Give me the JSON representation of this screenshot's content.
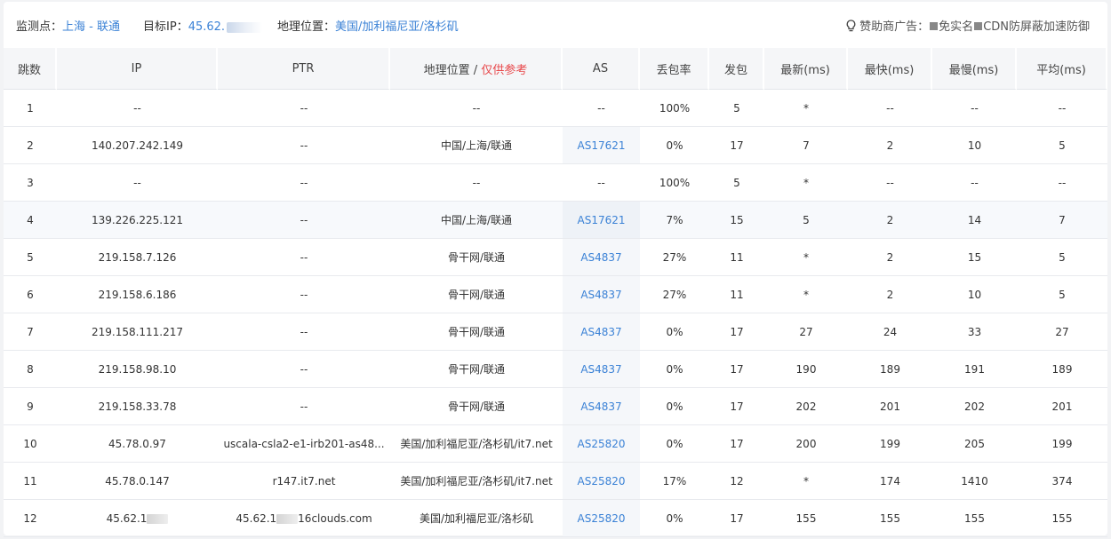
{
  "header": {
    "monitor_label": "监测点：",
    "monitor_value": "上海 - 联通",
    "target_label": "目标IP：",
    "target_value": "45.62.",
    "location_label": "地理位置：",
    "location_value": "美国/加利福尼亚/洛杉矶",
    "sponsor_label": "赞助商广告：",
    "sponsor_text_1": "免实名",
    "sponsor_text_2": "CDN防屏蔽加速防御"
  },
  "columns": {
    "hop": "跳数",
    "ip": "IP",
    "ptr": "PTR",
    "geo": "地理位置",
    "geo_sep": " / ",
    "geo_note": "仅供参考",
    "as": "AS",
    "loss": "丢包率",
    "sent": "发包",
    "last": "最新(ms)",
    "best": "最快(ms)",
    "worst": "最慢(ms)",
    "avg": "平均(ms)"
  },
  "rows": [
    {
      "hop": "1",
      "ip": "--",
      "ptr": "--",
      "geo": "--",
      "as": "--",
      "loss": "100%",
      "sent": "5",
      "last": "*",
      "best": "--",
      "worst": "--",
      "avg": "--"
    },
    {
      "hop": "2",
      "ip": "140.207.242.149",
      "ptr": "--",
      "geo": "中国/上海/联通",
      "as": "AS17621",
      "loss": "0%",
      "sent": "17",
      "last": "7",
      "best": "2",
      "worst": "10",
      "avg": "5"
    },
    {
      "hop": "3",
      "ip": "--",
      "ptr": "--",
      "geo": "--",
      "as": "--",
      "loss": "100%",
      "sent": "5",
      "last": "*",
      "best": "--",
      "worst": "--",
      "avg": "--"
    },
    {
      "hop": "4",
      "ip": "139.226.225.121",
      "ptr": "--",
      "geo": "中国/上海/联通",
      "as": "AS17621",
      "loss": "7%",
      "sent": "15",
      "last": "5",
      "best": "2",
      "worst": "14",
      "avg": "7"
    },
    {
      "hop": "5",
      "ip": "219.158.7.126",
      "ptr": "--",
      "geo": "骨干网/联通",
      "as": "AS4837",
      "loss": "27%",
      "sent": "11",
      "last": "*",
      "best": "2",
      "worst": "15",
      "avg": "5"
    },
    {
      "hop": "6",
      "ip": "219.158.6.186",
      "ptr": "--",
      "geo": "骨干网/联通",
      "as": "AS4837",
      "loss": "27%",
      "sent": "11",
      "last": "*",
      "best": "2",
      "worst": "10",
      "avg": "5"
    },
    {
      "hop": "7",
      "ip": "219.158.111.217",
      "ptr": "--",
      "geo": "骨干网/联通",
      "as": "AS4837",
      "loss": "0%",
      "sent": "17",
      "last": "27",
      "best": "24",
      "worst": "33",
      "avg": "27"
    },
    {
      "hop": "8",
      "ip": "219.158.98.10",
      "ptr": "--",
      "geo": "骨干网/联通",
      "as": "AS4837",
      "loss": "0%",
      "sent": "17",
      "last": "190",
      "best": "189",
      "worst": "191",
      "avg": "189"
    },
    {
      "hop": "9",
      "ip": "219.158.33.78",
      "ptr": "--",
      "geo": "骨干网/联通",
      "as": "AS4837",
      "loss": "0%",
      "sent": "17",
      "last": "202",
      "best": "201",
      "worst": "202",
      "avg": "201"
    },
    {
      "hop": "10",
      "ip": "45.78.0.97",
      "ptr": "uscala-csla2-e1-irb201-as48...",
      "geo": "美国/加利福尼亚/洛杉矶/it7.net",
      "as": "AS25820",
      "loss": "0%",
      "sent": "17",
      "last": "200",
      "best": "199",
      "worst": "205",
      "avg": "199"
    },
    {
      "hop": "11",
      "ip": "45.78.0.147",
      "ptr": "r147.it7.net",
      "geo": "美国/加利福尼亚/洛杉矶/it7.net",
      "as": "AS25820",
      "loss": "17%",
      "sent": "12",
      "last": "*",
      "best": "174",
      "worst": "1410",
      "avg": "374"
    },
    {
      "hop": "12",
      "ip": "45.62.1",
      "ptr_a": "45.62.1",
      "ptr_b": "16clouds.com",
      "geo": "美国/加利福尼亚/洛杉矶",
      "as": "AS25820",
      "loss": "0%",
      "sent": "17",
      "last": "155",
      "best": "155",
      "worst": "155",
      "avg": "155"
    }
  ]
}
